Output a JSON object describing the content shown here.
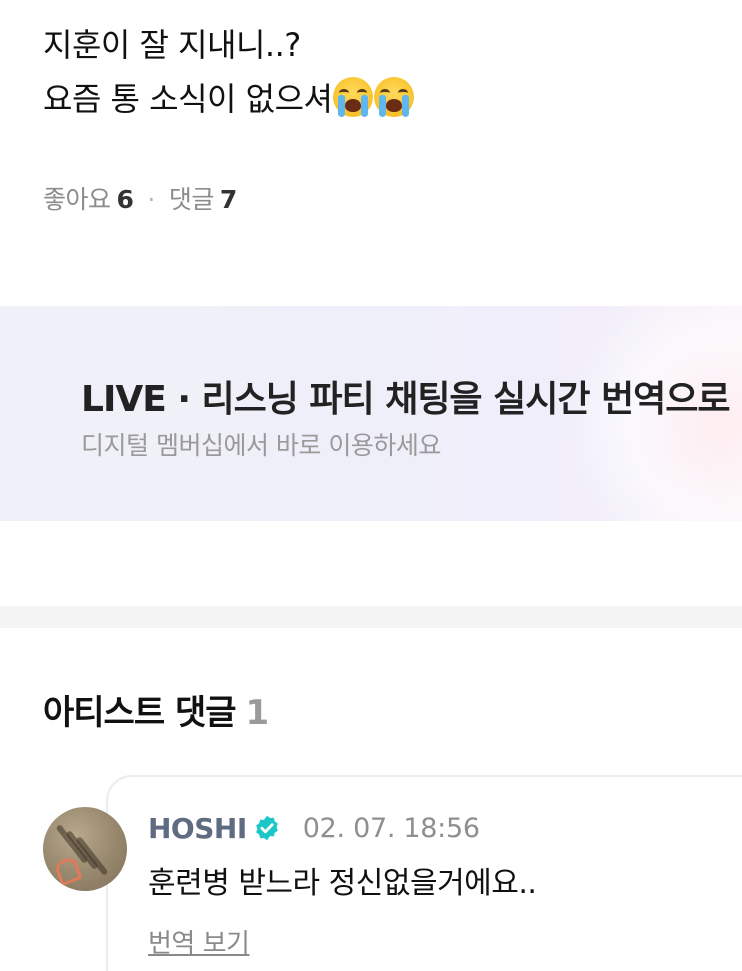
{
  "post": {
    "lines": [
      "지훈이 잘 지내니..?",
      "요즘 통 소식이 없으셔"
    ],
    "emoji_icons": [
      "loudly-crying-face-icon",
      "loudly-crying-face-icon"
    ]
  },
  "stats": {
    "likes_label": "좋아요",
    "likes_count": "6",
    "separator": "·",
    "comments_label": "댓글",
    "comments_count": "7"
  },
  "promo": {
    "title": "LIVE · 리스닝 파티 채팅을 실시간 번역으로",
    "subtitle": "디지털 멤버십에서 바로 이용하세요"
  },
  "artist_comments": {
    "title": "아티스트 댓글",
    "count": "1",
    "items": [
      {
        "author": "HOSHI",
        "verified_icon": "verified-badge-icon",
        "time": "02. 07. 18:56",
        "text": "훈련병 받느라 정신없을거에요..",
        "translate_label": "번역 보기"
      }
    ]
  },
  "colors": {
    "verified": "#1ec7c7",
    "author": "#5e6b80",
    "muted": "#8c8c8c"
  }
}
